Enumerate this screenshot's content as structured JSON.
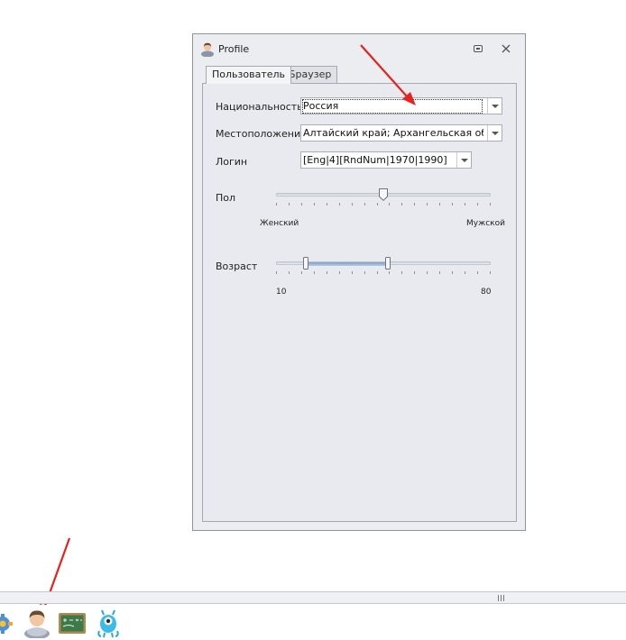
{
  "window": {
    "title": "Profile",
    "title_icon": "user-profile-icon"
  },
  "tabs": [
    {
      "label": "Пользователь",
      "active": true
    },
    {
      "label": "Браузер",
      "active": false
    }
  ],
  "fields": {
    "nationality": {
      "label": "Национальность",
      "value": "Россия"
    },
    "location": {
      "label": "Местоположение",
      "value": "Алтайский край; Архангельская обл..."
    },
    "login": {
      "label": "Логин",
      "value": "[Eng|4][RndNum|1970|1990]"
    }
  },
  "gender": {
    "label": "Пол",
    "min_label": "Женский",
    "max_label": "Мужской",
    "value_fraction": 0.5
  },
  "age": {
    "label": "Возраст",
    "min_label": "10",
    "max_label": "80",
    "range_fraction": [
      0.14,
      0.52
    ]
  },
  "taskbar": {
    "icons": [
      "gear-icon",
      "user-profile-icon",
      "chalkboard-icon",
      "monster-icon"
    ]
  },
  "colors": {
    "annotation_arrow": "#e8211c",
    "slider_fill": "#8fb0d6",
    "window_bg": "#ecedf1"
  }
}
